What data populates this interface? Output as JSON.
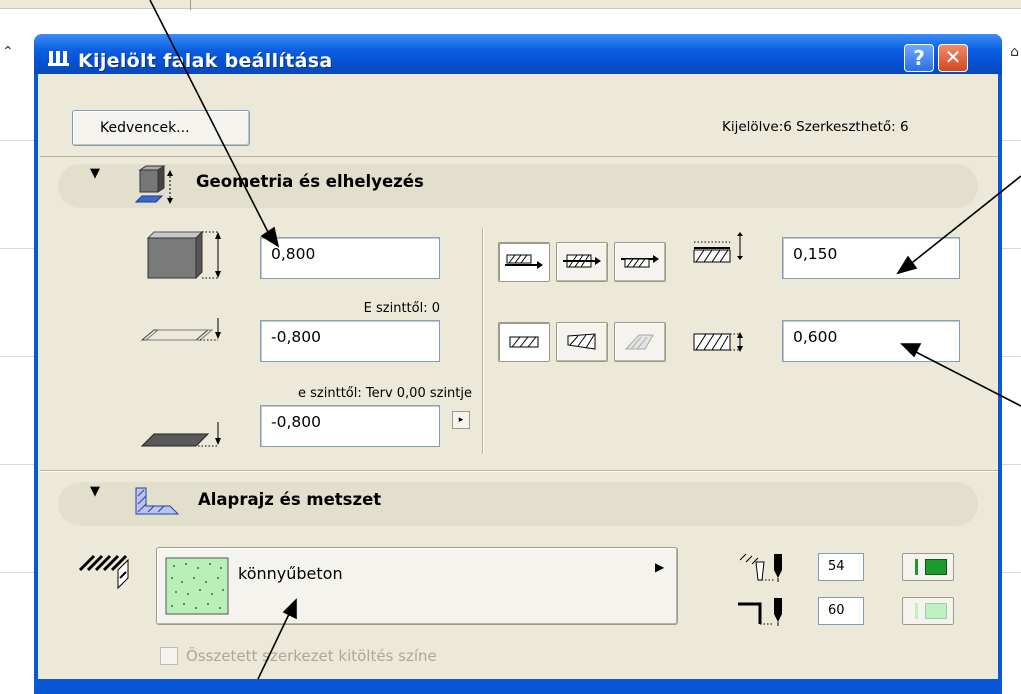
{
  "dialog": {
    "title": "Kijelölt falak beállítása",
    "help_label": "?",
    "close_label": "✕"
  },
  "toolbar": {
    "favorites_label": "Kedvencek...",
    "selection_info": "Kijelölve:6 Szerkeszthető: 6"
  },
  "geometry": {
    "section_title": "Geometria és elhelyezés",
    "wall_height": "0,800",
    "top_link_label": "E szinttől: 0",
    "top_offset": "-0,800",
    "base_link_label": "e szinttől: Terv 0,00 szintje",
    "base_offset": "-0,800",
    "offset_from_ref": "0,150",
    "wall_thickness": "0,600"
  },
  "plan": {
    "section_title": "Alaprajz és metszet",
    "fill_name": "könnyűbeton",
    "cut_line_pen": "54",
    "outline_pen": "60",
    "composite_fill_label": "Összetett szerkezet kitöltés színe"
  },
  "colors": {
    "title_bar": "#0a57d6",
    "dialog_bg": "#ece9d8",
    "fill_green": "#b9f0b9",
    "pen_green": "#1a9b2c",
    "pen_light_green": "#bff0c0"
  }
}
